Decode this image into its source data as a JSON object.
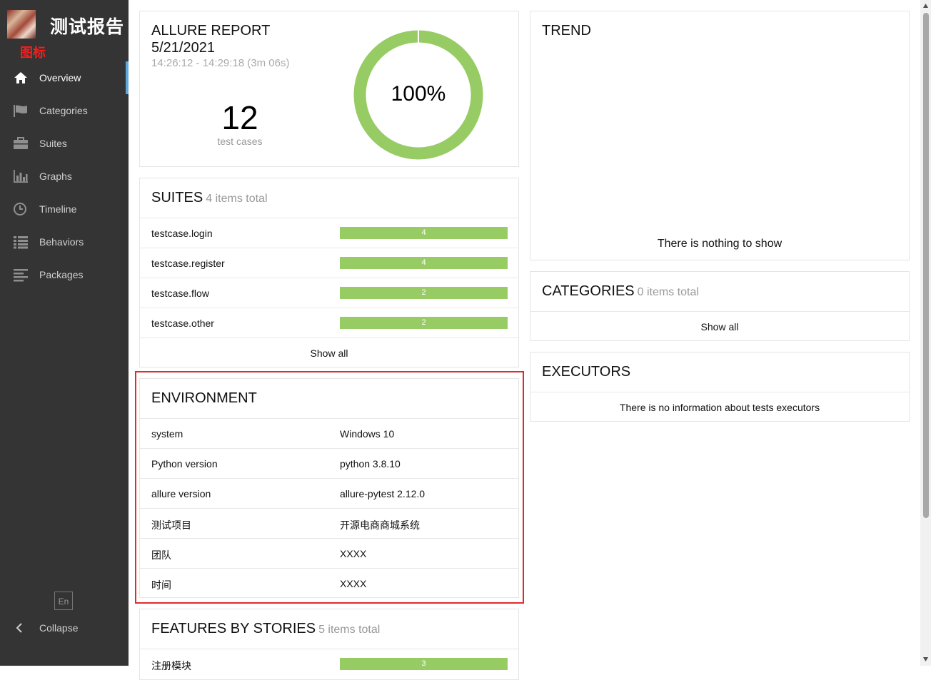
{
  "brand": {
    "title": "测试报告",
    "logo_caption": "图标"
  },
  "nav": [
    {
      "label": "Overview",
      "icon": "home-icon"
    },
    {
      "label": "Categories",
      "icon": "flag-icon"
    },
    {
      "label": "Suites",
      "icon": "briefcase-icon"
    },
    {
      "label": "Graphs",
      "icon": "bar-chart-icon"
    },
    {
      "label": "Timeline",
      "icon": "clock-icon"
    },
    {
      "label": "Behaviors",
      "icon": "list-icon"
    },
    {
      "label": "Packages",
      "icon": "align-left-icon"
    }
  ],
  "sidebar_footer": {
    "lang": "En",
    "collapse": "Collapse"
  },
  "summary": {
    "title": "ALLURE REPORT",
    "date": "5/21/2021",
    "time_range": "14:26:12 - 14:29:18 (3m 06s)",
    "count": "12",
    "count_label": "test cases",
    "percent": "100%",
    "passed_fraction": 1.0
  },
  "suites": {
    "title": "SUITES",
    "subtitle": "4 items total",
    "items": [
      {
        "name": "testcase.login",
        "value": "4"
      },
      {
        "name": "testcase.register",
        "value": "4"
      },
      {
        "name": "testcase.flow",
        "value": "2"
      },
      {
        "name": "testcase.other",
        "value": "2"
      }
    ],
    "show_all": "Show all"
  },
  "environment": {
    "title": "ENVIRONMENT",
    "rows": [
      {
        "key": "system",
        "value": "Windows 10"
      },
      {
        "key": "Python version",
        "value": "python 3.8.10"
      },
      {
        "key": "allure version",
        "value": "allure-pytest 2.12.0"
      },
      {
        "key": "测试项目",
        "value": "开源电商商城系统"
      },
      {
        "key": "团队",
        "value": "XXXX"
      },
      {
        "key": "时间",
        "value": "XXXX"
      }
    ]
  },
  "features": {
    "title": "FEATURES BY STORIES",
    "subtitle": "5 items total",
    "first_item": {
      "name": "注册模块",
      "value": "3"
    }
  },
  "trend": {
    "title": "TREND",
    "empty": "There is nothing to show"
  },
  "categories": {
    "title": "CATEGORIES",
    "subtitle": "0 items total",
    "show_all": "Show all"
  },
  "executors": {
    "title": "EXECUTORS",
    "empty": "There is no information about tests executors"
  },
  "colors": {
    "passed": "#97cc64",
    "sidebar": "#343434",
    "accent": "#5fa8dc",
    "highlight": "#e02b2b"
  }
}
